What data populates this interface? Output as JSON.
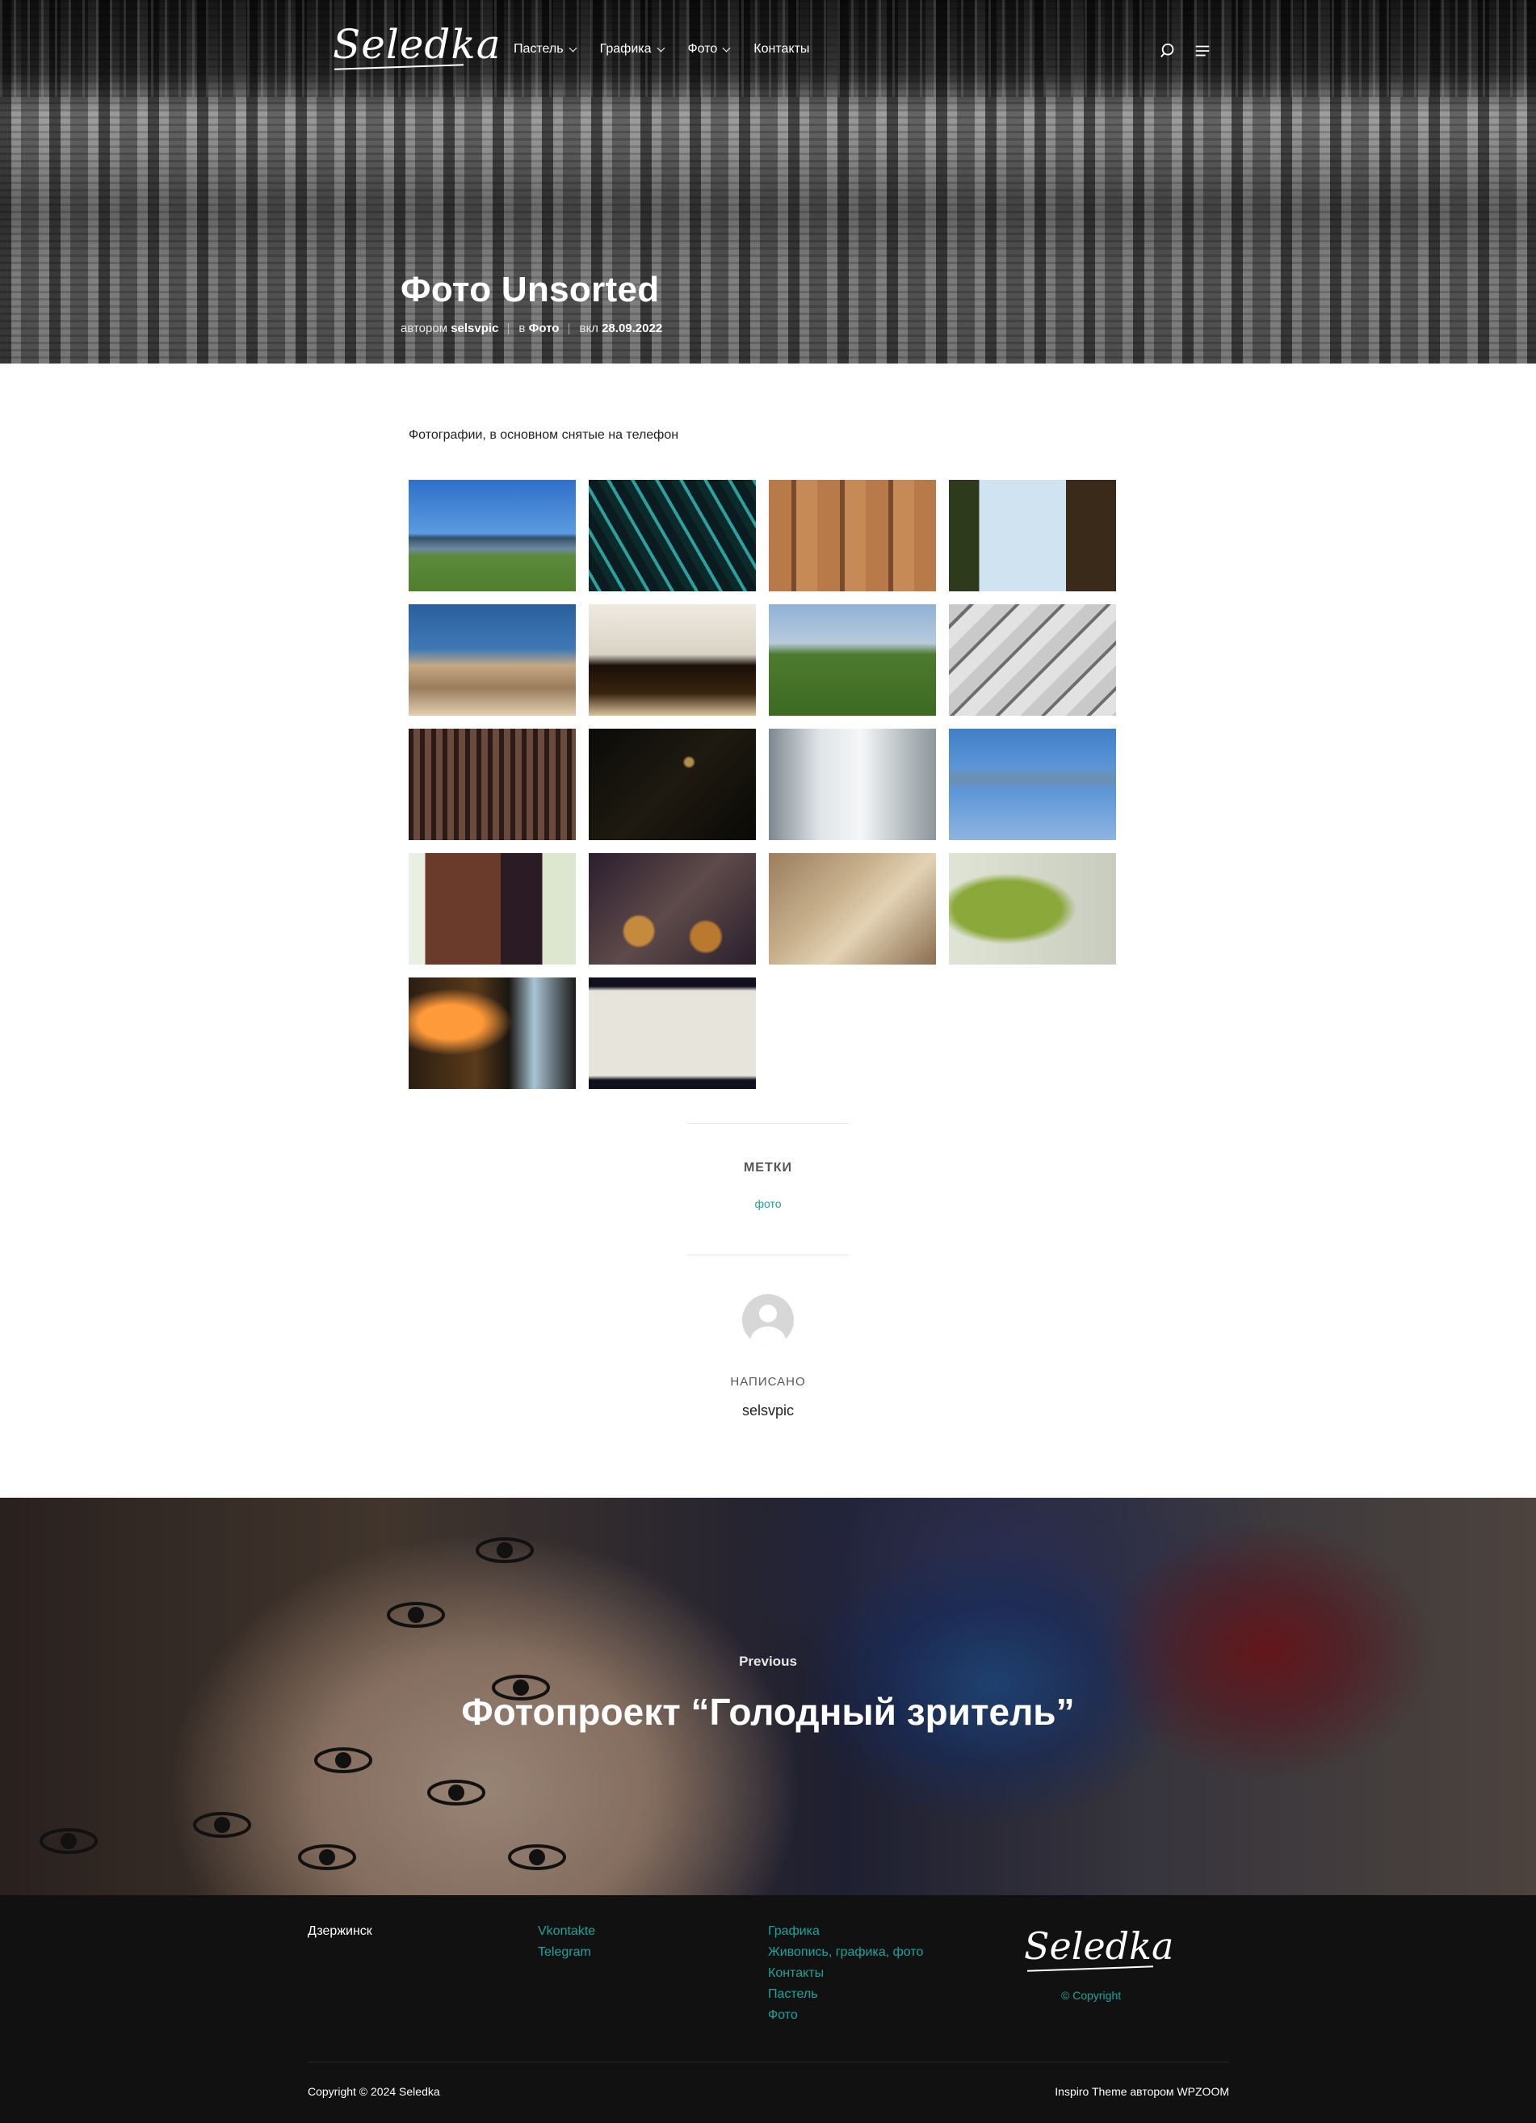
{
  "site": {
    "logo_text": "Seledka"
  },
  "nav": {
    "items": [
      {
        "label": "Пастель",
        "dropdown": true
      },
      {
        "label": "Графика",
        "dropdown": true
      },
      {
        "label": "Фото",
        "dropdown": true
      },
      {
        "label": "Контакты",
        "dropdown": false
      }
    ],
    "icons": [
      "search-icon",
      "menu-icon"
    ]
  },
  "post": {
    "title": "Фото Unsorted",
    "meta": {
      "by_prefix": "автором",
      "author": "selsvpic",
      "in_prefix": "в",
      "category": "Фото",
      "on_prefix": "вкл",
      "date": "28.09.2022"
    },
    "intro": "Фотографии, в основном снятые на телефон",
    "gallery_count": 18,
    "tags_heading": "МЕТКИ",
    "tags": [
      "фото"
    ],
    "written_by": "НАПИСАНО",
    "author_name": "selsvpic"
  },
  "previous": {
    "label": "Previous",
    "title": "Фотопроект “Голодный зритель”"
  },
  "footer": {
    "city": "Дзержинск",
    "social": [
      "Vkontakte",
      "Telegram"
    ],
    "categories": [
      "Графика",
      "Живопись, графика, фото",
      "Контакты",
      "Пастель",
      "Фото"
    ],
    "logo_text": "Seledka",
    "logo_caption": "© Copyright",
    "copyright": "Copyright © 2024 Seledka",
    "theme_credit": "Inspiro Theme автором WPZOOM"
  },
  "colors": {
    "accent": "#1aa59b",
    "footer_bg": "#111111",
    "text": "#222222"
  }
}
